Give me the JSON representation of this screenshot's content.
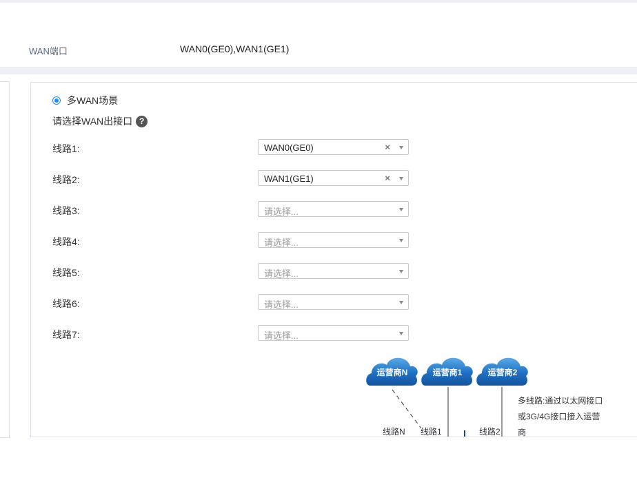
{
  "wan_port": {
    "label": "WAN端口",
    "value": "WAN0(GE0),WAN1(GE1)"
  },
  "scenario": {
    "radio_label": "多WAN场景",
    "selected": true
  },
  "wan_select": {
    "title": "请选择WAN出接口",
    "help_glyph": "?"
  },
  "select": {
    "clear_glyph": "×"
  },
  "lines": [
    {
      "label": "线路1:",
      "value": "WAN0(GE0)",
      "placeholder": ""
    },
    {
      "label": "线路2:",
      "value": "WAN1(GE1)",
      "placeholder": ""
    },
    {
      "label": "线路3:",
      "value": "",
      "placeholder": "请选择..."
    },
    {
      "label": "线路4:",
      "value": "",
      "placeholder": "请选择..."
    },
    {
      "label": "线路5:",
      "value": "",
      "placeholder": "请选择..."
    },
    {
      "label": "线路6:",
      "value": "",
      "placeholder": "请选择..."
    },
    {
      "label": "线路7:",
      "value": "",
      "placeholder": "请选择..."
    }
  ],
  "diagram": {
    "clouds": [
      "运营商N",
      "运营商1",
      "运营商2"
    ],
    "line_labels": [
      "线路N",
      "线路1",
      "线路2"
    ],
    "description": "多线路:通过以太网接口或3G/4G接口接入运营商"
  },
  "colors": {
    "accent": "#1890ff",
    "cloud": "#1f6fc2",
    "band": "#eef0f6",
    "border": "#dcdfe6"
  }
}
